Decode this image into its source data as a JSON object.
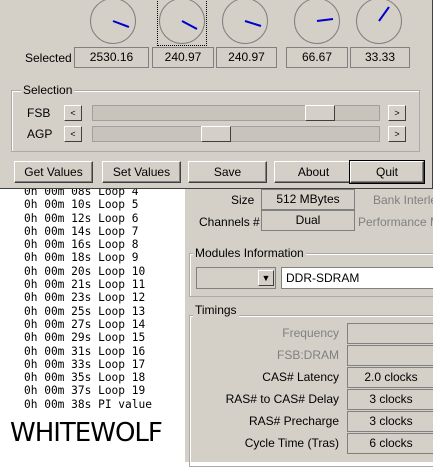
{
  "dialog": {
    "selected_label": "Selected",
    "values": [
      "2530.16",
      "240.97",
      "240.97",
      "66.67",
      "33.33"
    ],
    "selection_group_title": "Selection",
    "fsb_label": "FSB",
    "agp_label": "AGP",
    "fsb_slider_position": 0.82,
    "agp_slider_position": 0.42,
    "buttons": {
      "get_values": "Get Values",
      "set_values": "Set Values",
      "save": "Save",
      "about": "About",
      "quit": "Quit"
    }
  },
  "console": {
    "lines": [
      "0h 00m 08s Loop 4",
      "0h 00m 10s Loop 5",
      "0h 00m 12s Loop 6",
      "0h 00m 14s Loop 7",
      "0h 00m 16s Loop 8",
      "0h 00m 18s Loop 9",
      "0h 00m 20s Loop 10",
      "0h 00m 21s Loop 11",
      "0h 00m 23s Loop 12",
      "0h 00m 25s Loop 13",
      "0h 00m 27s Loop 14",
      "0h 00m 29s Loop 15",
      "0h 00m 31s Loop 16",
      "0h 00m 33s Loop 17",
      "0h 00m 35s Loop 18",
      "0h 00m 37s Loop 19",
      "0h 00m 38s PI value"
    ],
    "watermark": "WHITEWOLF"
  },
  "memory_panel": {
    "size_label": "Size",
    "size_value": "512 MBytes",
    "bank_label": "Bank Interle",
    "channels_label": "Channels #",
    "channels_value": "Dual",
    "performance_label": "Performance M",
    "modules_title": "Modules Information",
    "module_type": "DDR-SDRAM",
    "timings_title": "Timings",
    "timings": [
      {
        "label": "Frequency",
        "value": "",
        "enabled": false
      },
      {
        "label": "FSB:DRAM",
        "value": "",
        "enabled": false
      },
      {
        "label": "CAS# Latency",
        "value": "2.0 clocks",
        "enabled": true
      },
      {
        "label": "RAS# to CAS# Delay",
        "value": "3 clocks",
        "enabled": true
      },
      {
        "label": "RAS# Precharge",
        "value": "3 clocks",
        "enabled": true
      },
      {
        "label": "Cycle Time (Tras)",
        "value": "6 clocks",
        "enabled": true
      }
    ]
  }
}
